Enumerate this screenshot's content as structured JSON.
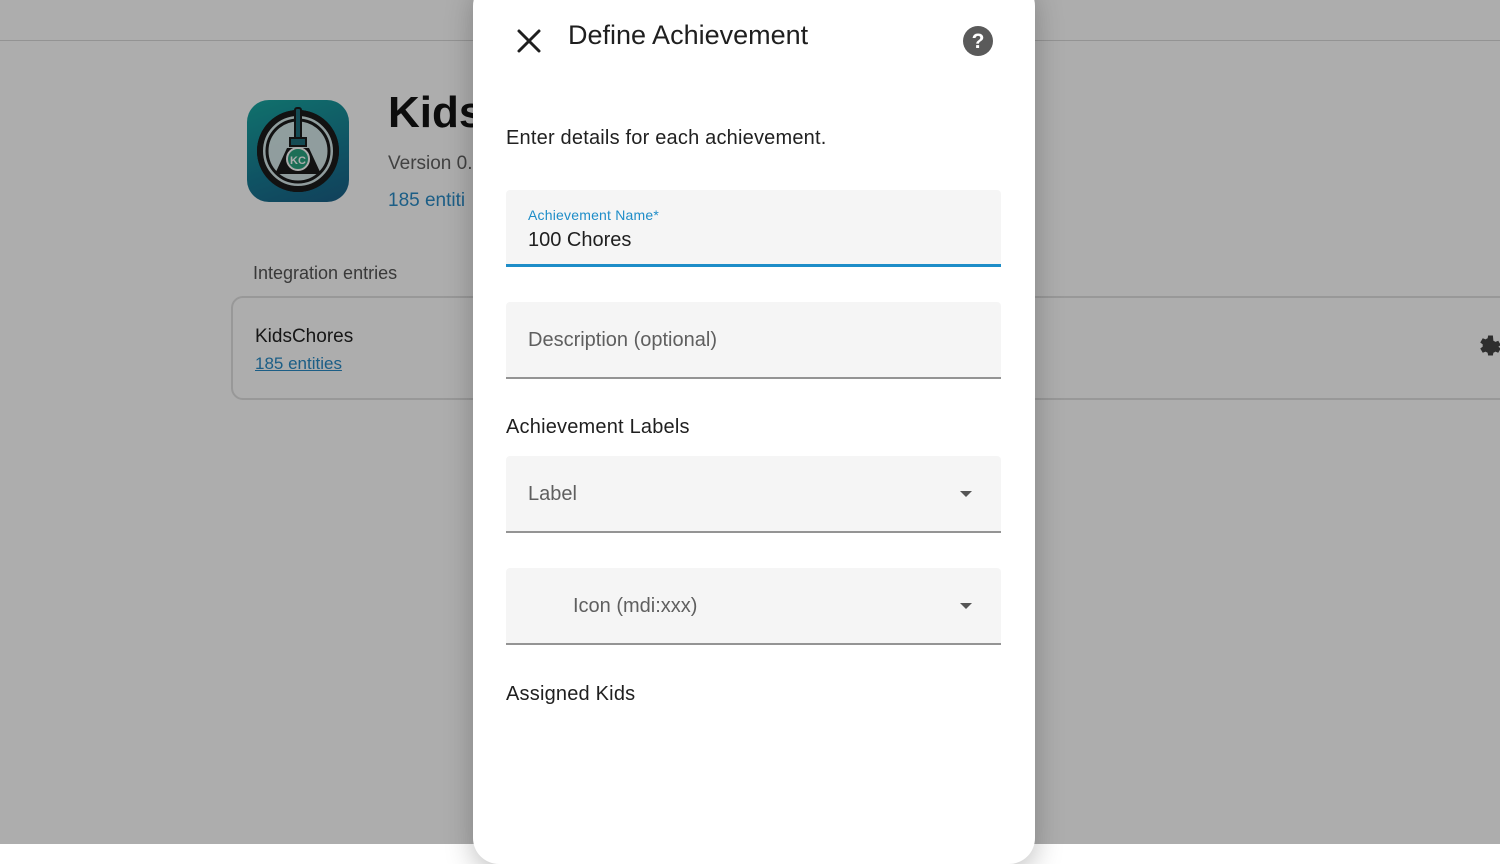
{
  "background": {
    "app_title": "Kids",
    "version_text": "Version 0.",
    "entities_link": "185 entiti",
    "entries_heading": "Integration entries",
    "entry": {
      "title": "KidsChores",
      "entities_link": "185 entities"
    },
    "logo": {
      "monogram": "KC"
    }
  },
  "dialog": {
    "title": "Define Achievement",
    "intro": "Enter details for each achievement.",
    "fields": {
      "name": {
        "label": "Achievement Name*",
        "value": "100 Chores"
      },
      "description": {
        "placeholder": "Description (optional)"
      },
      "label_select": {
        "placeholder": "Label"
      },
      "icon": {
        "placeholder": "Icon (mdi:xxx)"
      }
    },
    "sections": {
      "labels_heading": "Achievement Labels",
      "assigned_kids_heading": "Assigned Kids"
    }
  },
  "colors": {
    "accent": "#1e8dc8",
    "scrim": "rgba(0,0,0,0.32)",
    "logo_teal": "#1aa7a0"
  }
}
